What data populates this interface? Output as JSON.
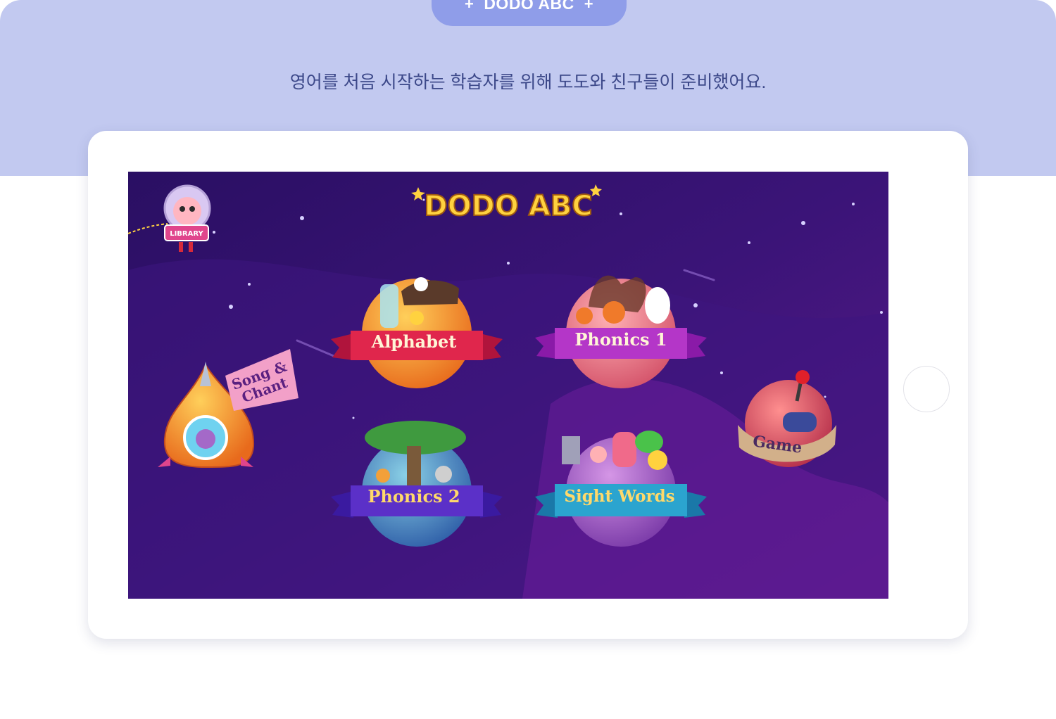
{
  "header": {
    "pill_plus_left": "+",
    "pill_title": "DODO ABC",
    "pill_plus_right": "+",
    "subtitle": "영어를 처음 시작하는 학습자를 위해 도도와 친구들이 준비했어요."
  },
  "app": {
    "logo": "DODO ABC",
    "library_label": "LIBRARY",
    "song_chant_line1": "Song &",
    "song_chant_line2": "Chant",
    "alphabet": "Alphabet",
    "phonics1": "Phonics 1",
    "phonics2": "Phonics 2",
    "sight_words": "Sight Words",
    "game": "Game"
  },
  "colors": {
    "band": "#c2c9f0",
    "pill": "#8f9de9",
    "subtitle": "#3c4889",
    "space_dark": "#2a0f63",
    "space_purple": "#5a1a8a"
  }
}
